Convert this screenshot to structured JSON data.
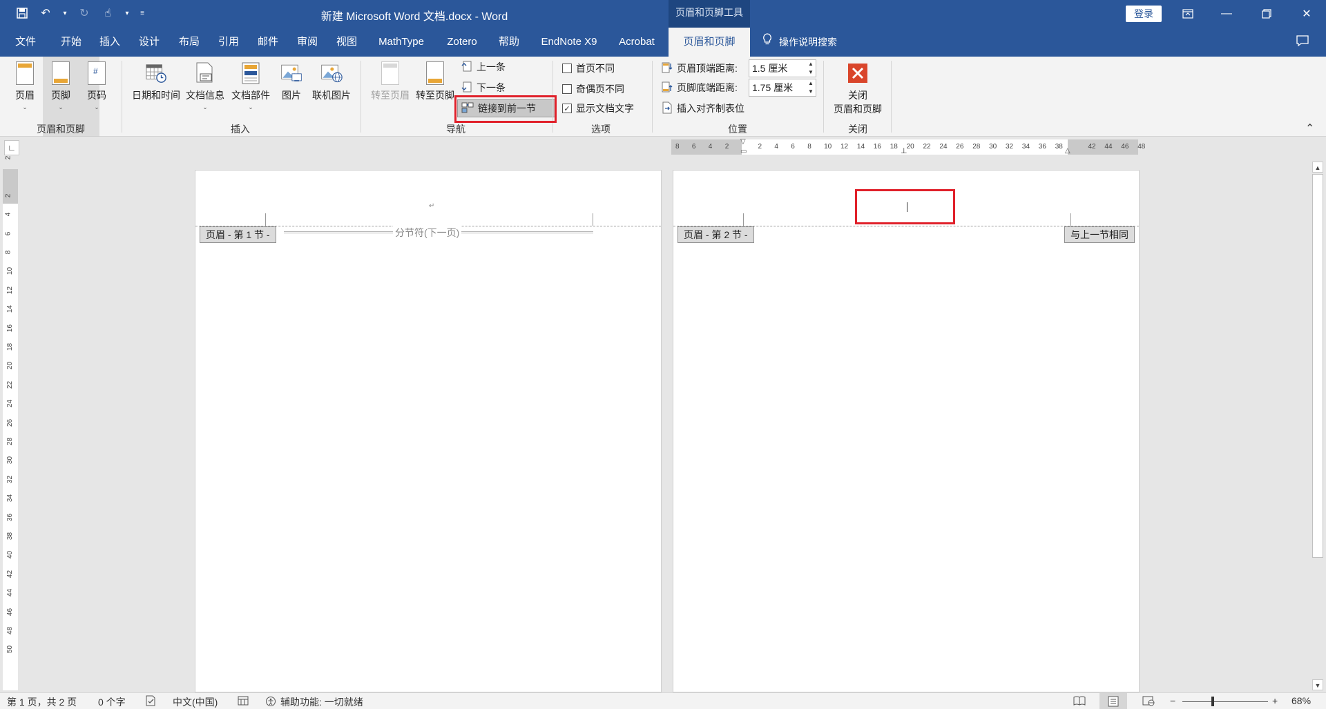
{
  "titlebar": {
    "document_title": "新建 Microsoft Word 文档.docx  -  Word",
    "context_tools_label": "页眉和页脚工具",
    "login_label": "登录",
    "accent_color": "#2b579a"
  },
  "menu": {
    "tabs": [
      "文件",
      "开始",
      "插入",
      "设计",
      "布局",
      "引用",
      "邮件",
      "审阅",
      "视图",
      "MathType",
      "Zotero",
      "帮助",
      "EndNote X9",
      "Acrobat",
      "页眉和页脚"
    ],
    "active_tab": "页眉和页脚",
    "search_label": "操作说明搜索"
  },
  "ribbon": {
    "hf_group": {
      "label": "页眉和页脚",
      "header_btn": "页眉",
      "footer_btn": "页脚",
      "pagenum_btn": "页码",
      "tooltip_value": "0"
    },
    "insert_group": {
      "label": "插入",
      "datetime_btn": "日期和时间",
      "docinfo_btn": "文档信息",
      "docparts_btn": "文档部件",
      "picture_btn": "图片",
      "online_picture_btn": "联机图片"
    },
    "nav_group": {
      "label": "导航",
      "goto_header_btn": "转至页眉",
      "goto_footer_btn": "转至页脚",
      "prev_btn": "上一条",
      "next_btn": "下一条",
      "link_prev_btn": "链接到前一节"
    },
    "options_group": {
      "label": "选项",
      "diff_first_page": "首页不同",
      "diff_odd_even": "奇偶页不同",
      "show_doc_text": "显示文档文字"
    },
    "position_group": {
      "label": "位置",
      "header_from_top_label": "页眉顶端距离:",
      "header_from_top_value": "1.5 厘米",
      "footer_from_bottom_label": "页脚底端距离:",
      "footer_from_bottom_value": "1.75 厘米",
      "insert_align_tab": "插入对齐制表位"
    },
    "close_group": {
      "label": "关闭",
      "close_btn_line1": "关闭",
      "close_btn_line2": "页眉和页脚"
    }
  },
  "hruler_ticks": [
    "8",
    "6",
    "4",
    "2",
    "2",
    "4",
    "6",
    "8",
    "10",
    "12",
    "14",
    "16",
    "18",
    "20",
    "22",
    "24",
    "26",
    "28",
    "30",
    "32",
    "34",
    "36",
    "38",
    "42",
    "44",
    "46",
    "48"
  ],
  "vruler_ticks": [
    "2",
    "2",
    "4",
    "6",
    "8",
    "10",
    "12",
    "14",
    "16",
    "18",
    "20",
    "22",
    "24",
    "26",
    "28",
    "30",
    "32",
    "34",
    "36",
    "38",
    "40",
    "42",
    "44",
    "46",
    "48",
    "50"
  ],
  "pages": {
    "page1_header_tag": "页眉 - 第 1 节 -",
    "page1_section_break": "分节符(下一页)",
    "page1_para_mark": "↵",
    "page2_header_tag": "页眉 - 第 2 节 -",
    "page2_same_as_prev": "与上一节相同"
  },
  "statusbar": {
    "page_info": "第 1 页，共 2 页",
    "word_count": "0 个字",
    "language": "中文(中国)",
    "accessibility": "辅助功能: 一切就绪",
    "zoom_level": "68%",
    "zoom_minus": "−",
    "zoom_plus": "+"
  }
}
